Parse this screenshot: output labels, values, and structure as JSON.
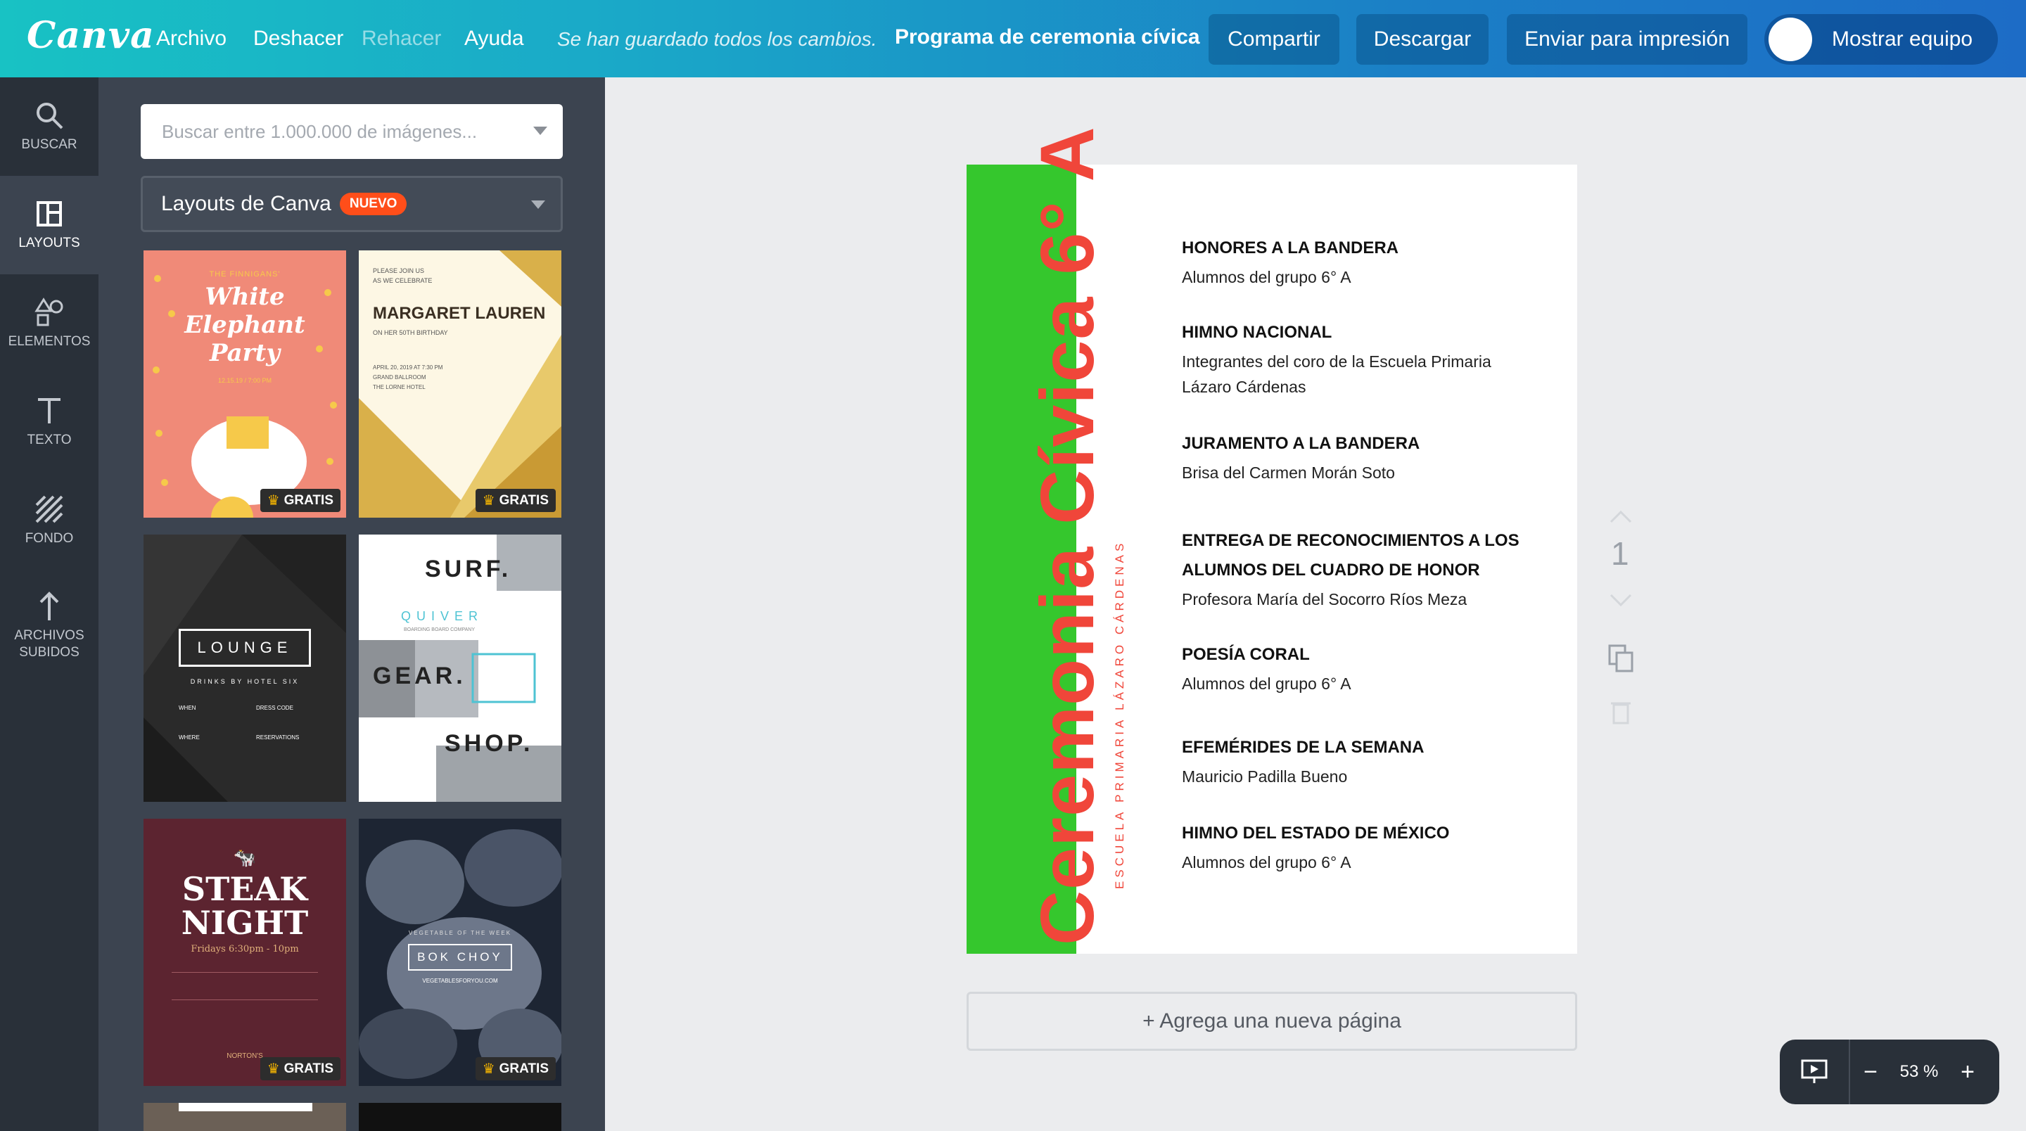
{
  "app": {
    "logo": "Canva",
    "menu": [
      "Archivo",
      "Deshacer",
      "Rehacer",
      "Ayuda"
    ],
    "saved_status": "Se han guardado todos los cambios.",
    "doc_title": "Programa de ceremonia cívica",
    "share_label": "Compartir",
    "download_label": "Descargar",
    "print_label": "Enviar para impresión",
    "team_label": "Mostrar equipo"
  },
  "rail": [
    {
      "label": "BUSCAR",
      "icon": "search-icon"
    },
    {
      "label": "LAYOUTS",
      "icon": "layouts-icon"
    },
    {
      "label": "ELEMENTOS",
      "icon": "elements-icon"
    },
    {
      "label": "TEXTO",
      "icon": "text-icon"
    },
    {
      "label": "FONDO",
      "icon": "background-icon"
    },
    {
      "label1": "ARCHIVOS",
      "label2": "SUBIDOS",
      "icon": "upload-icon"
    }
  ],
  "panel": {
    "search_placeholder": "Buscar entre 1.000.000 de imágenes...",
    "layouts_label": "Layouts de Canva",
    "new_badge": "NUEVO",
    "free_badge": "GRATIS",
    "thumbs": {
      "t1": {
        "top": "THE FINNIGANS'",
        "l1": "White",
        "l2": "Elephant",
        "l3": "Party",
        "sub": "12.15.19 / 7:00 PM"
      },
      "t2": {
        "top1": "PLEASE JOIN US",
        "top2": "AS WE CELEBRATE",
        "name": "MARGARET LAUREN",
        "sub": "ON HER 50TH BIRTHDAY",
        "d1": "APRIL 20, 2019 AT 7:30 PM",
        "d2": "GRAND BALLROOM",
        "d3": "THE LORNE HOTEL"
      },
      "t3": {
        "title": "LOUNGE",
        "sub": "DRINKS BY HOTEL SIX",
        "c1": "WHEN",
        "c2": "DRESS CODE",
        "c3": "WHERE",
        "c4": "RESERVATIONS"
      },
      "t4": {
        "w1": "SURF.",
        "w2": "QUIVER",
        "w2sub": "BOARDING BOARD COMPANY",
        "w3": "GEAR.",
        "w4": "SHOP."
      },
      "t5": {
        "l1": "STEAK",
        "l2": "NIGHT",
        "sub": "Fridays 6:30pm - 10pm",
        "brand": "NORTON'S"
      },
      "t6": {
        "top": "VEGETABLE OF THE WEEK",
        "title": "BOK CHOY",
        "url": "VEGETABLESFORYOU.COM"
      }
    }
  },
  "page": {
    "vertical_title": "Ceremonia Cívica 6° A",
    "vertical_subtitle": "ESCUELA PRIMARIA LÁZARO CÁRDENAS",
    "accent_green": "#35c72d",
    "accent_red": "#f0463a",
    "program": [
      {
        "heading": "HONORES A LA BANDERA",
        "detail": "Alumnos del grupo 6° A"
      },
      {
        "heading": "HIMNO NACIONAL",
        "detail": "Integrantes del coro de la Escuela Primaria Lázaro Cárdenas"
      },
      {
        "heading": "JURAMENTO A LA BANDERA",
        "detail": "Brisa del Carmen Morán Soto"
      },
      {
        "heading": "ENTREGA DE RECONOCIMIENTOS A LOS ALUMNOS DEL CUADRO DE HONOR",
        "detail": "Profesora María del Socorro Ríos Meza"
      },
      {
        "heading": "POESÍA CORAL",
        "detail": "Alumnos del grupo 6° A"
      },
      {
        "heading": "EFEMÉRIDES DE LA SEMANA",
        "detail": "Mauricio Padilla Bueno"
      },
      {
        "heading": "HIMNO DEL ESTADO DE MÉXICO",
        "detail": "Alumnos del grupo 6° A"
      }
    ],
    "page_number": "1"
  },
  "add_page_label": "+ Agrega una nueva página",
  "zoom": {
    "value": "53 %",
    "minus": "−",
    "plus": "+"
  }
}
